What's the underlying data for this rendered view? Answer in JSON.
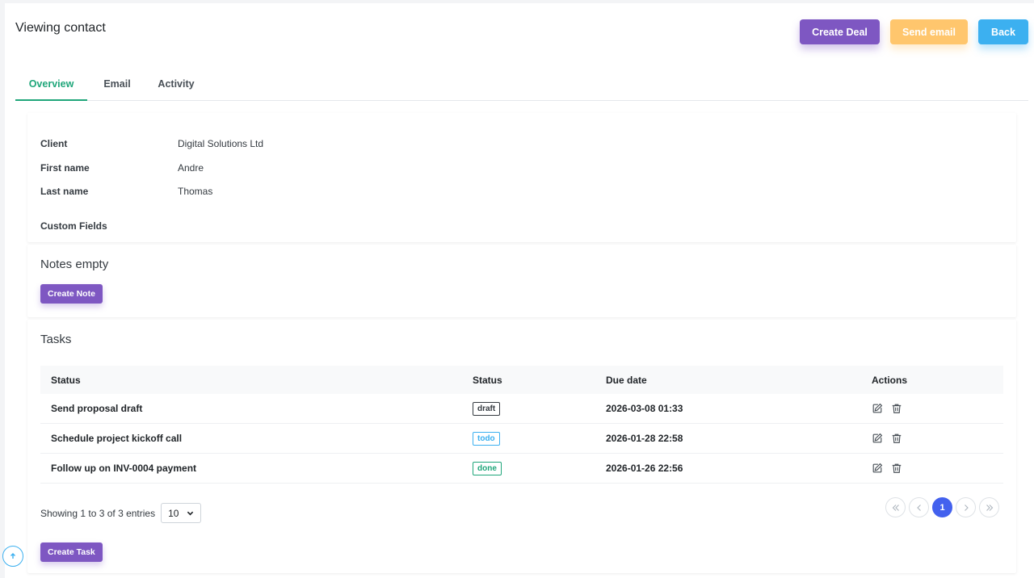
{
  "header": {
    "title": "Viewing contact",
    "buttons": {
      "create_deal": "Create Deal",
      "send_email": "Send email",
      "back": "Back"
    }
  },
  "tabs": [
    {
      "label": "Overview",
      "active": true
    },
    {
      "label": "Email",
      "active": false
    },
    {
      "label": "Activity",
      "active": false
    }
  ],
  "contact": {
    "client_label": "Client",
    "client_value": "Digital Solutions Ltd",
    "first_name_label": "First name",
    "first_name_value": "Andre",
    "last_name_label": "Last name",
    "last_name_value": "Thomas",
    "custom_fields_label": "Custom Fields"
  },
  "notes": {
    "title": "Notes empty",
    "create_label": "Create Note"
  },
  "tasks": {
    "title": "Tasks",
    "columns": [
      "Status",
      "Status",
      "Due date",
      "Actions"
    ],
    "rows": [
      {
        "name": "Send proposal draft",
        "status": "draft",
        "due": "2026-03-08 01:33"
      },
      {
        "name": "Schedule project kickoff call",
        "status": "todo",
        "due": "2026-01-28 22:58"
      },
      {
        "name": "Follow up on INV-0004 payment",
        "status": "done",
        "due": "2026-01-26 22:56"
      }
    ],
    "showing": "Showing 1 to 3 of 3 entries",
    "page_size": "10",
    "current_page": "1",
    "create_label": "Create Task"
  },
  "icons": {
    "edit": "edit-icon",
    "delete": "trash-icon",
    "scroll_top": "arrow-up-icon"
  },
  "colors": {
    "purple": "#7e57c2",
    "yellow": "#ffc66d",
    "blue": "#3cb0f0",
    "green": "#1fa67a",
    "pager_active": "#4361ee"
  }
}
